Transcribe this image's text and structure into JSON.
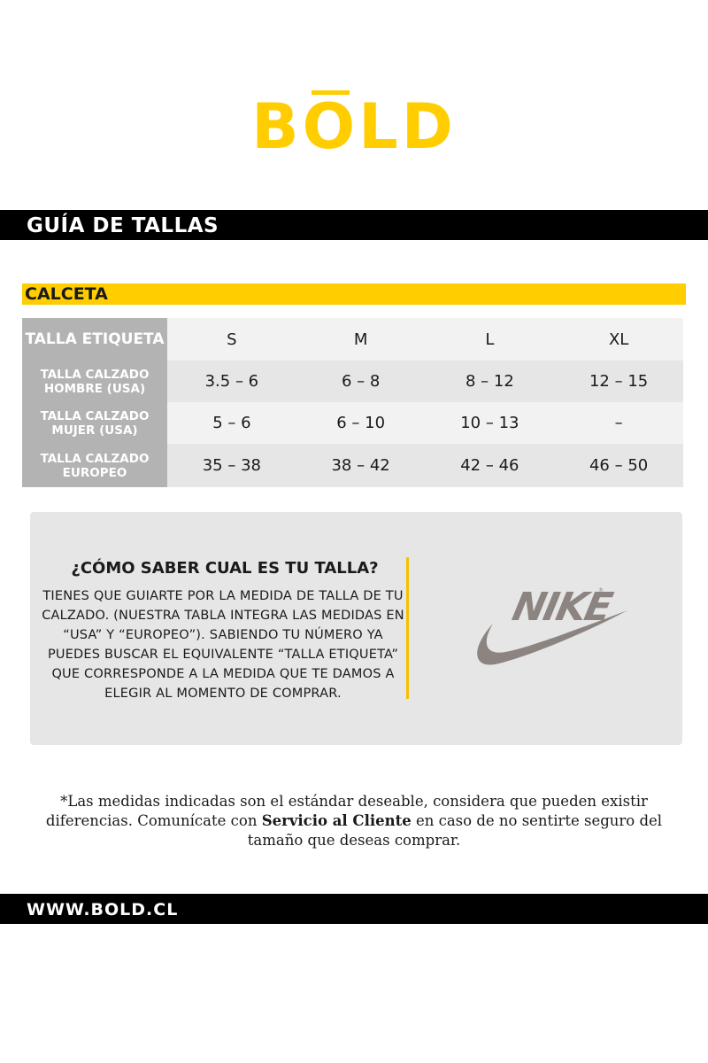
{
  "brand": {
    "logo_letters": [
      "B",
      "O",
      "L",
      "D"
    ],
    "logo_aria": "BŌLD",
    "accent_color": "#ffcd00"
  },
  "header": {
    "title": "GUÍA DE TALLAS"
  },
  "section": {
    "title": "CALCETA",
    "color": "#ffcd00"
  },
  "size_table": {
    "rows": [
      {
        "label": "TALLA ETIQUETA",
        "values": [
          "S",
          "M",
          "L",
          "XL"
        ]
      },
      {
        "label": "TALLA CALZADO HOMBRE (USA)",
        "values": [
          "3.5 – 6",
          "6 – 8",
          "8 – 12",
          "12 – 15"
        ]
      },
      {
        "label": "TALLA CALZADO MUJER (USA)",
        "values": [
          "5 – 6",
          "6 – 10",
          "10 – 13",
          "–"
        ]
      },
      {
        "label": "TALLA CALZADO EUROPEO",
        "values": [
          "35 – 38",
          "38 – 42",
          "42 – 46",
          "46 – 50"
        ]
      }
    ]
  },
  "info": {
    "title": "¿CÓMO SABER CUAL ES TU TALLA?",
    "body": "Tienes que guiarte por la medida de talla de tu calzado. (Nuestra tabla integra las medidas en “USA” y “europeo”). Sabiendo tu número ya puedes buscar el equivalente “talla etiqueta” que corresponde a la medida que te damos a elegir al momento de comprar.",
    "brand_logo_text": "NIKE",
    "brand_logo_icon": "swoosh-icon",
    "divider_color": "#f5c000",
    "brand_logo_color": "#8c8480"
  },
  "disclaimer": {
    "text_before": "*Las medidas indicadas son el estándar deseable, considera que pueden existir diferencias. Comunícate con ",
    "highlight": "Servicio al Cliente",
    "text_after": " en caso de no sentirte seguro del tamaño que deseas comprar."
  },
  "footer": {
    "url": "WWW.BOLD.CL"
  }
}
